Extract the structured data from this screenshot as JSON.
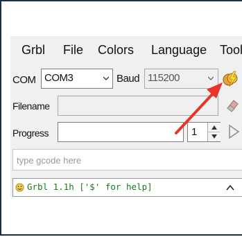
{
  "menu": [
    "Grbl",
    "File",
    "Colors",
    "Language",
    "Tool"
  ],
  "com": {
    "label": "COM",
    "value": "COM3"
  },
  "baud": {
    "label": "Baud",
    "value": "115200"
  },
  "filename": {
    "label": "Filename",
    "value": ""
  },
  "progress": {
    "label": "Progress",
    "count": "1"
  },
  "gcode": {
    "placeholder": "type gcode here"
  },
  "console": {
    "text": "Grbl 1.1h ['$' for help]"
  },
  "icons": [
    "connect-icon",
    "eraser-icon",
    "play-icon",
    "smiley-icon",
    "scroll-up-icon"
  ],
  "colors": {
    "border": "#1a2c4a",
    "annotation_arrow": "#e8322a",
    "console_text": "#1a7a1a"
  }
}
